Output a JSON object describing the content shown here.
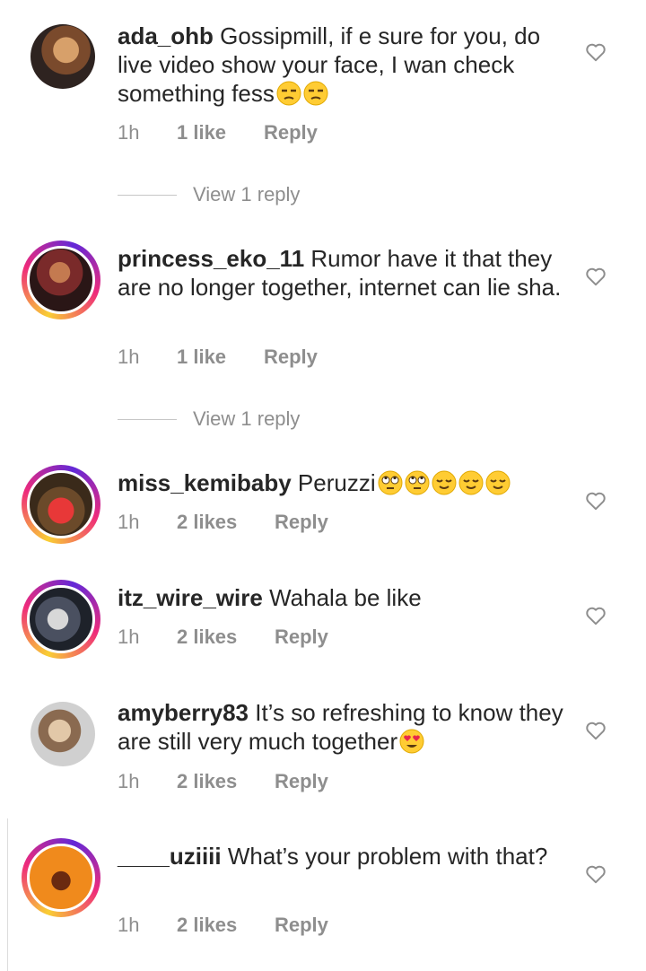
{
  "comments": [
    {
      "username": "ada_ohb",
      "text": "Gossipmill, if e sure for you, do live video show your face, I wan check something fess",
      "emojis": [
        "unamused-face",
        "unamused-face"
      ],
      "time": "1h",
      "likes": "1 like",
      "reply": "Reply",
      "view_replies": "View 1 reply",
      "avatar_colors": [
        "#c98a52",
        "#3a2a22"
      ]
    },
    {
      "username": "princess_eko_11",
      "text": "Rumor have it that they are no longer together, internet can lie sha.",
      "emojis": [],
      "time": "1h",
      "likes": "1 like",
      "reply": "Reply",
      "view_replies": "View 1 reply",
      "avatar_colors": [
        "#8b2b2b",
        "#2a1a1a"
      ]
    },
    {
      "username": "miss_kemibaby",
      "text": "Peruzzi",
      "emojis": [
        "rolling-eyes-face",
        "rolling-eyes-face",
        "relieved-face",
        "relieved-face",
        "relieved-face"
      ],
      "time": "1h",
      "likes": "2 likes",
      "reply": "Reply",
      "avatar_colors": [
        "#e23a3a",
        "#6b4a2a"
      ]
    },
    {
      "username": "itz_wire_wire",
      "text": "Wahala be like",
      "emojis": [],
      "time": "1h",
      "likes": "2 likes",
      "reply": "Reply",
      "avatar_colors": [
        "#2a2f3a",
        "#b8b8b8"
      ]
    },
    {
      "username": "amyberry83",
      "text": "It’s so refreshing to know they are still very much together",
      "emojis": [
        "heart-eyes-face"
      ],
      "time": "1h",
      "likes": "2 likes",
      "reply": "Reply",
      "avatar_colors": [
        "#d8c0a0",
        "#3a2a20"
      ]
    },
    {
      "username": "____uziiii",
      "text": "What’s your problem with that?",
      "emojis": [],
      "time": "1h",
      "likes": "2 likes",
      "reply": "Reply",
      "avatar_colors": [
        "#f08a1c",
        "#5a2a10"
      ]
    }
  ],
  "colors": {
    "text": "#262626",
    "meta": "#8e8e8e",
    "story_ring": [
      "#f9ce34",
      "#ee2a7b",
      "#6228d7"
    ]
  }
}
